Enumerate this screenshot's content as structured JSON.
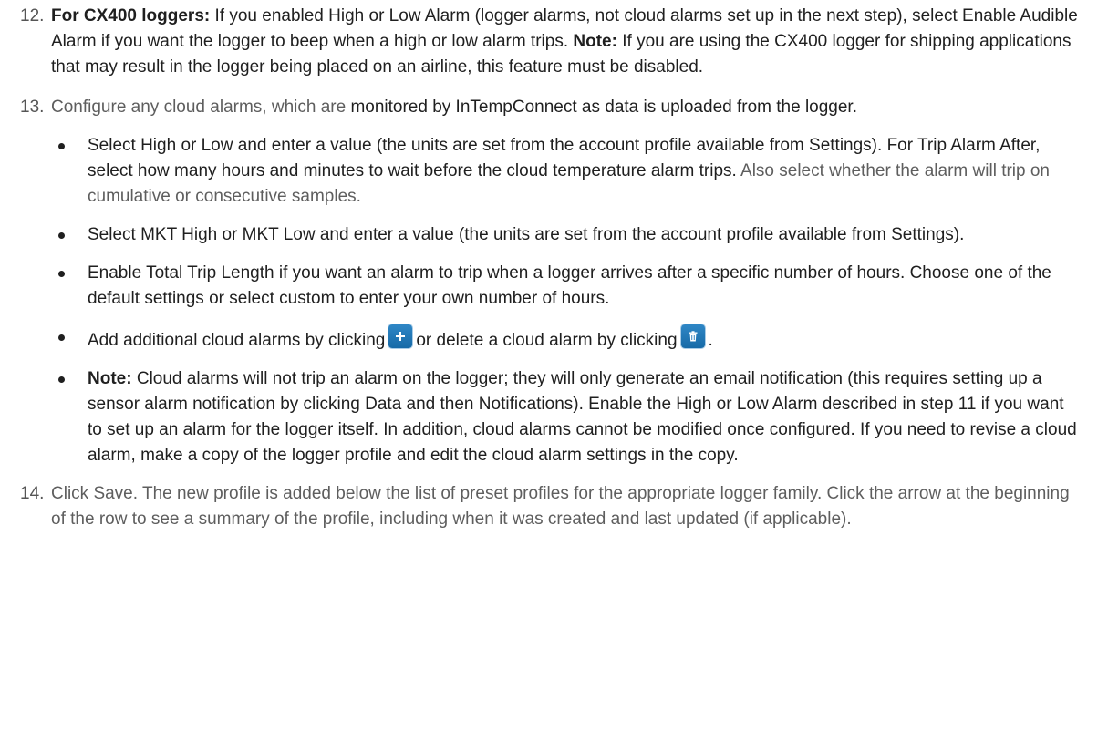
{
  "steps": [
    {
      "num": "12.",
      "lead_bold": "For CX400 loggers:",
      "text1": " If you enabled High or Low Alarm (logger alarms, not cloud alarms set up in the next step), select Enable Audible Alarm if you want the logger to beep when a high or low alarm trips. ",
      "note_bold": "Note:",
      "text2": " If you are using the CX400 logger for shipping applications that may result in the logger being placed on an airline, this feature must be disabled."
    },
    {
      "num": "13.",
      "intro_muted": "Configure any cloud alarms, which are ",
      "intro_dark": "monitored by InTempConnect as data is uploaded from the logger.",
      "bullets": {
        "b1_main": "Select High or Low and enter a value (the units are set from the account profile available from Settings). For Trip Alarm After, select how many hours and minutes to wait before the cloud temperature alarm trips.",
        "b1_muted": " Also select whether the alarm will trip on cumulative or consecutive samples.",
        "b2": "Select MKT High or MKT Low and enter a value (the units are set from the account profile available from Settings).",
        "b3": "Enable Total Trip Length if you want an alarm to trip when a logger arrives after a specific number of hours. Choose one of the default settings or select custom to enter your own number of hours.",
        "b4_part1": "Add additional cloud alarms by clicking",
        "b4_part2": "or delete a cloud alarm by clicking",
        "b4_end": ".",
        "b5_bold": "Note:",
        "b5_text": " Cloud alarms will not trip an alarm on the logger; they will only generate an email notification (this requires setting up a sensor alarm notification by clicking Data and then Notifications). Enable the High or Low Alarm described in step 11 if you want to set up an alarm for the logger itself. In addition, cloud alarms cannot be modified once configured. If you need to revise a cloud alarm, make a copy of the logger profile and edit the cloud alarm settings in the copy."
      }
    },
    {
      "num": "14.",
      "text": "Click Save. The new profile is added below the list of preset profiles for the appropriate logger family. Click the arrow at the beginning of the row to see a summary of the profile, including when it was created and last updated (if applicable)."
    }
  ],
  "icons": {
    "add": "plus-icon",
    "delete": "trash-icon",
    "button_color": "#2177b8"
  }
}
